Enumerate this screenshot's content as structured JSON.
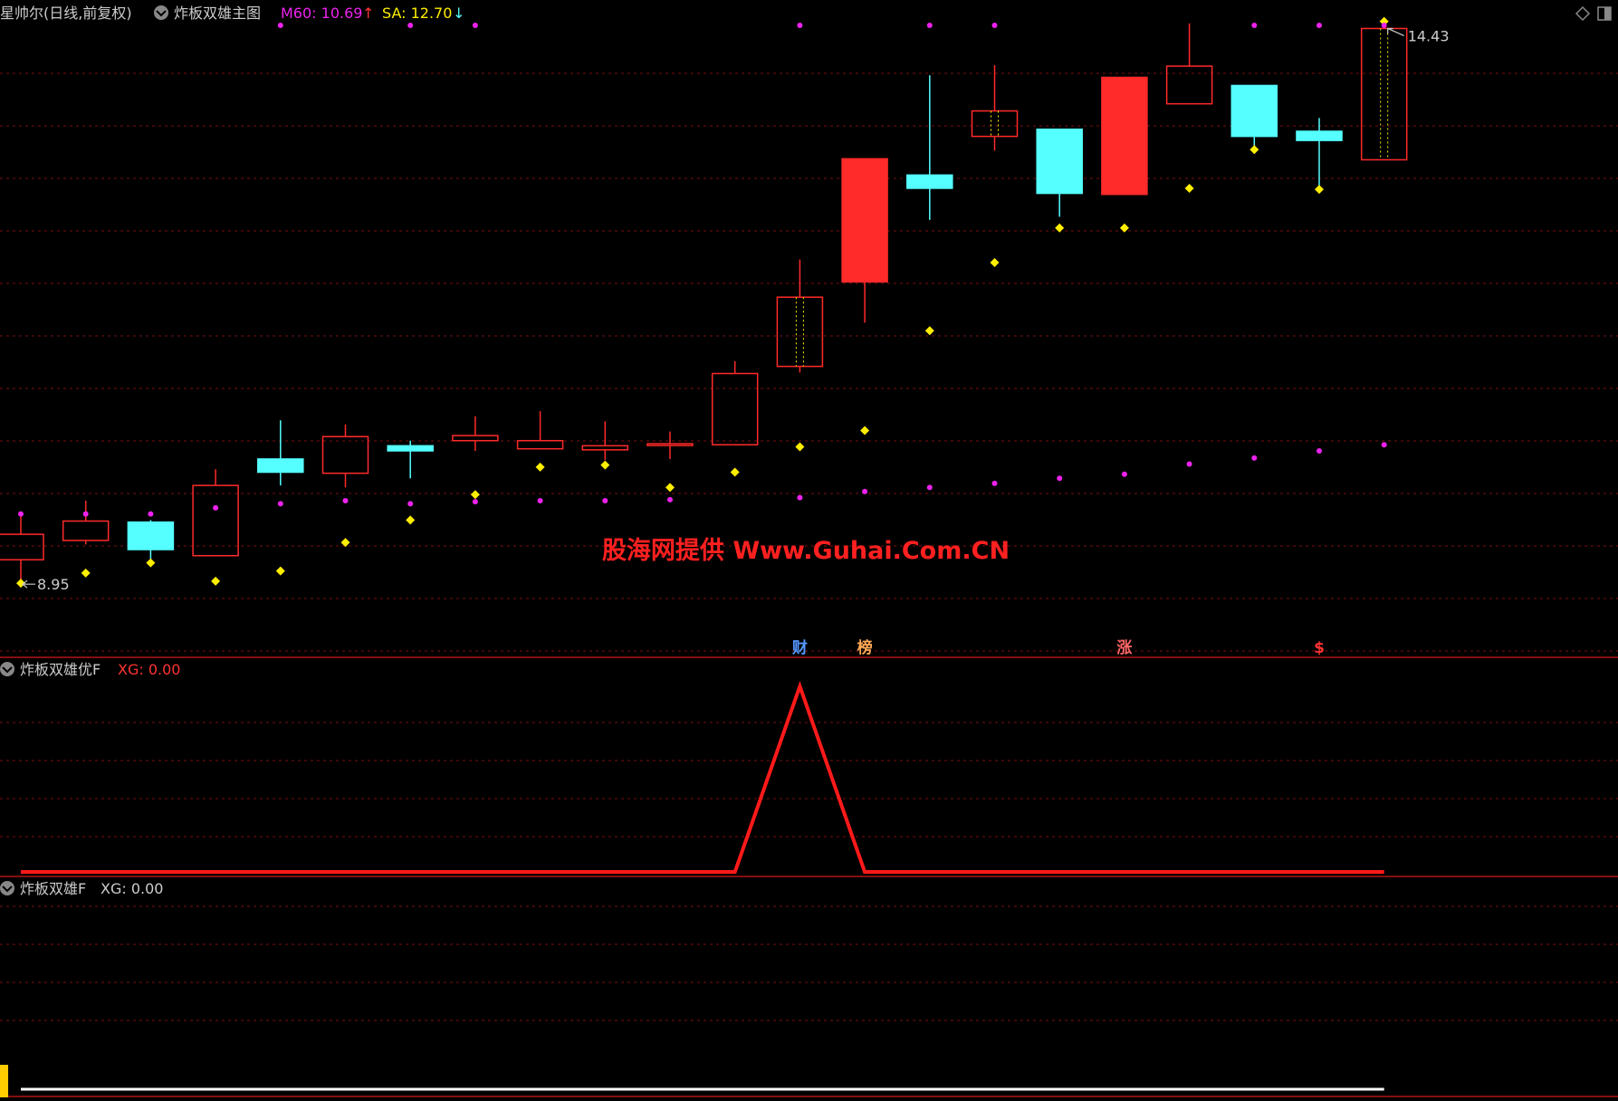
{
  "header": {
    "main_title": "星帅尔(日线,前复权)",
    "indicator_name": "炸板双雄主图",
    "m60_label": "M60: 10.69",
    "m60_arrow": "↑",
    "sa_label": "SA: 12.70",
    "sa_arrow": "↓"
  },
  "watermark": "股海网提供 Www.Guhai.Com.CN",
  "pane2_header": {
    "name": "炸板双雄优F",
    "value_label": "XG: 0.00"
  },
  "pane3_header": {
    "name": "炸板双雄F",
    "value_label": "XG: 0.00"
  },
  "markers": [
    {
      "text": "财",
      "index": 12,
      "color": "#5599ff"
    },
    {
      "text": "榜",
      "index": 13,
      "color": "#ffaa55"
    },
    {
      "text": "涨",
      "index": 17,
      "color": "#ff6666"
    },
    {
      "text": "$",
      "index": 20,
      "color": "#ff3333"
    }
  ],
  "colors": {
    "up": "#ff2a2a",
    "down": "#55ffff",
    "grid": "#7a1010",
    "divider": "#b01515",
    "dot_yellow": "#ffee00",
    "dot_magenta": "#ee22ee",
    "m60": "#ee22ee",
    "sa": "#ffee00"
  },
  "chart_data": [
    {
      "type": "candlestick",
      "title": "星帅尔(日线,前复权)",
      "ylim": [
        8.3,
        14.75
      ],
      "low_label": "8.95",
      "low_index": 0,
      "high_label": "14.43",
      "high_index": 21,
      "candles": [
        {
          "open": 9.25,
          "close": 9.5,
          "high": 9.69,
          "low": 9.01
        },
        {
          "open": 9.44,
          "close": 9.63,
          "high": 9.83,
          "low": 9.4
        },
        {
          "open": 9.62,
          "close": 9.35,
          "high": 9.64,
          "low": 9.26
        },
        {
          "open": 9.29,
          "close": 9.98,
          "high": 10.14,
          "low": 9.29
        },
        {
          "open": 10.24,
          "close": 10.11,
          "high": 10.62,
          "low": 9.98
        },
        {
          "open": 10.1,
          "close": 10.46,
          "high": 10.58,
          "low": 9.96
        },
        {
          "open": 10.37,
          "close": 10.32,
          "high": 10.42,
          "low": 10.05
        },
        {
          "open": 10.42,
          "close": 10.47,
          "high": 10.66,
          "low": 10.32
        },
        {
          "open": 10.34,
          "close": 10.42,
          "high": 10.71,
          "low": 10.34
        },
        {
          "open": 10.33,
          "close": 10.37,
          "high": 10.61,
          "low": 10.23
        },
        {
          "open": 10.38,
          "close": 10.39,
          "high": 10.51,
          "low": 10.24
        },
        {
          "open": 10.38,
          "close": 11.08,
          "high": 11.2,
          "low": 10.38
        },
        {
          "open": 11.15,
          "close": 11.83,
          "high": 12.2,
          "low": 11.09
        },
        {
          "open": 11.98,
          "close": 13.19,
          "high": 13.19,
          "low": 11.58
        },
        {
          "open": 13.03,
          "close": 12.9,
          "high": 14.01,
          "low": 12.59
        },
        {
          "open": 13.41,
          "close": 13.66,
          "high": 14.11,
          "low": 13.27
        },
        {
          "open": 13.48,
          "close": 12.85,
          "high": 13.48,
          "low": 12.62
        },
        {
          "open": 12.84,
          "close": 13.99,
          "high": 13.99,
          "low": 12.84
        },
        {
          "open": 13.73,
          "close": 14.1,
          "high": 14.52,
          "low": 13.73
        },
        {
          "open": 13.91,
          "close": 13.41,
          "high": 13.91,
          "low": 13.3
        },
        {
          "open": 13.46,
          "close": 13.37,
          "high": 13.59,
          "low": 12.91
        },
        {
          "open": 13.18,
          "close": 14.47,
          "high": 14.47,
          "low": 13.18
        }
      ],
      "sa_dots": [
        9.02,
        9.12,
        9.22,
        9.04,
        9.14,
        9.42,
        9.64,
        9.89,
        10.16,
        10.18,
        9.96,
        10.11,
        10.36,
        10.52,
        11.5,
        12.17,
        12.51,
        12.51,
        12.9,
        13.28,
        12.89,
        14.54
      ],
      "m60_dots": [
        9.7,
        9.7,
        9.7,
        9.76,
        9.8,
        9.83,
        9.8,
        9.82,
        9.83,
        9.83,
        9.84,
        null,
        9.86,
        9.92,
        9.96,
        10.0,
        10.05,
        10.09,
        10.19,
        10.25,
        10.32,
        10.38
      ],
      "m60_top_row": [
        null,
        null,
        null,
        null,
        1,
        null,
        1,
        1,
        null,
        null,
        null,
        null,
        1,
        null,
        1,
        1,
        null,
        null,
        null,
        1,
        1,
        1
      ]
    },
    {
      "type": "line",
      "title": "炸板双雄优F",
      "series": [
        {
          "name": "XG",
          "values": [
            0,
            0,
            0,
            0,
            0,
            0,
            0,
            0,
            0,
            0,
            0,
            0,
            1,
            0,
            0,
            0,
            0,
            0,
            0,
            0,
            0,
            0
          ]
        }
      ],
      "ylim": [
        0,
        1
      ]
    },
    {
      "type": "line",
      "title": "炸板双雄F",
      "series": [
        {
          "name": "XG",
          "values": [
            0,
            0,
            0,
            0,
            0,
            0,
            0,
            0,
            0,
            0,
            0,
            0,
            0,
            0,
            0,
            0,
            0,
            0,
            0,
            0,
            0,
            0
          ]
        }
      ],
      "ylim": [
        0,
        1
      ]
    }
  ]
}
